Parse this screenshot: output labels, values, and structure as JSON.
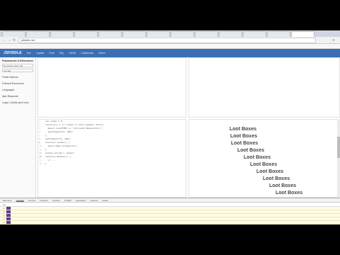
{
  "browser": {
    "tabs": [
      "",
      "",
      "",
      "",
      "",
      "",
      "",
      "",
      "",
      "",
      "",
      "",
      ""
    ],
    "url": "jsfiddle.net",
    "bookmarks": [
      "",
      "",
      "",
      "",
      "",
      "",
      "",
      ""
    ]
  },
  "header": {
    "logo": "JSFIDDLE",
    "buttons": [
      "Run",
      "Update",
      "Fork",
      "Tidy",
      "JSHint",
      "Collaborate",
      "Share"
    ]
  },
  "sidebar": {
    "section_title": "Frameworks & Extensions",
    "framework_value": "No-Library (pure JS)",
    "load_type": "onLoad",
    "links": [
      "Fiddle Options",
      "External Resources",
      "Languages",
      "Ajax Requests",
      "Legal, Credits and Links"
    ]
  },
  "js_code": [
    "var index = 0;",
    "function() { if (index >= loot.length) return;",
    "  panel.innerHTML += '<div>Loot Boxes</div>';",
    "  setTimeout(fn, 100);",
    "}",
    "",
    "setTimeout(fn, 100);",
    "",
    "function render() {",
    "  data.items.forEach(fn);",
    "}",
    "",
    "window.onload = render;",
    "",
    "",
    "function Handler() {",
    "  // ...",
    "}"
  ],
  "result": {
    "lines": [
      "Loot Boxes",
      "Loot Boxes",
      "Loot Boxes",
      "Loot Boxes",
      "Loot Boxes",
      "Loot Boxes",
      "Loot Boxes",
      "Loot Boxes",
      "Loot Boxes",
      "Loot Boxes"
    ]
  },
  "devtools": {
    "tabs": [
      "Elements",
      "Console",
      "Sources",
      "Network",
      "Timeline",
      "Profiles",
      "Application",
      "Security",
      "Audits"
    ],
    "active_tab": "Console",
    "filter": "top",
    "log_rows": [
      "",
      "",
      "",
      "",
      "",
      "",
      "",
      ""
    ]
  },
  "colors": {
    "header_blue": "#3b6fb2",
    "warning_bg": "#fffbe6",
    "badge_purple": "#5b3f8f"
  }
}
